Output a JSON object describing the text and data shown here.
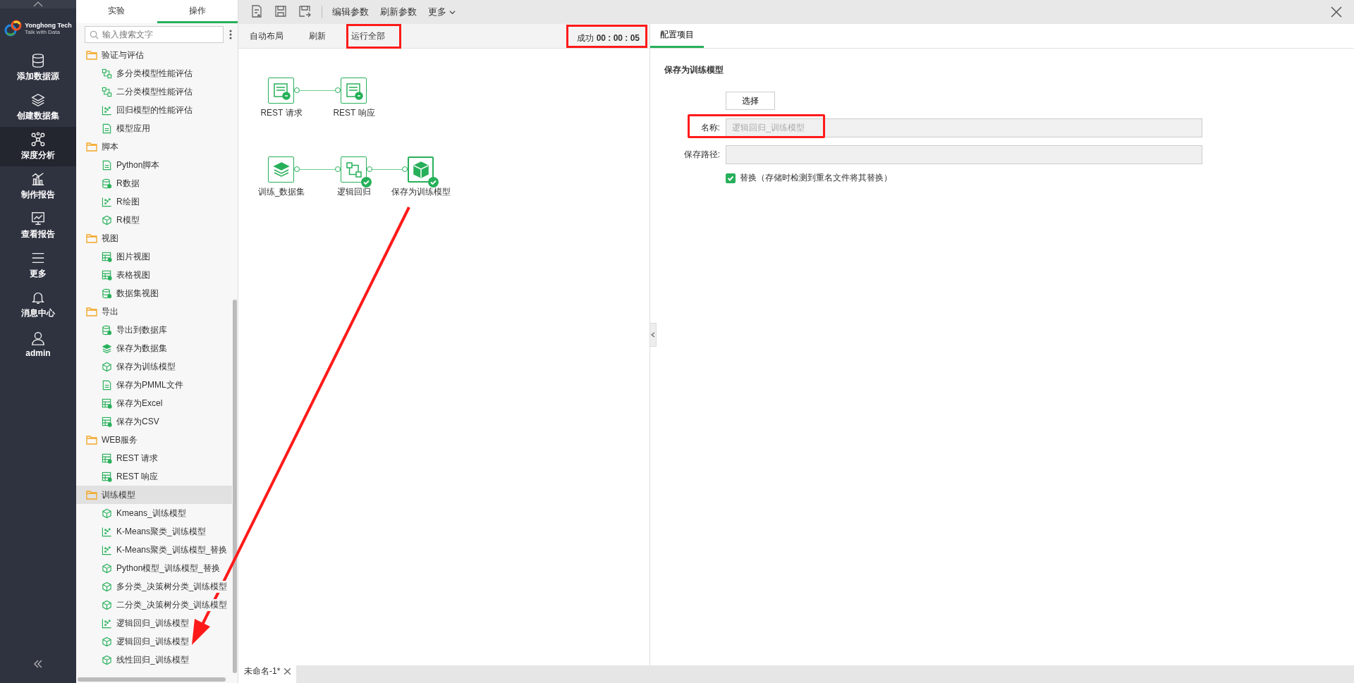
{
  "nav": {
    "logo": {
      "title": "Yonghong Tech",
      "tagline": "Talk with Data"
    },
    "items": [
      {
        "label": "添加数据源",
        "kind": "database",
        "selected": false
      },
      {
        "label": "创建数据集",
        "kind": "layers",
        "selected": false
      },
      {
        "label": "深度分析",
        "kind": "network",
        "selected": true
      },
      {
        "label": "制作报告",
        "kind": "chart",
        "selected": false
      },
      {
        "label": "查看报告",
        "kind": "monitor",
        "selected": false
      },
      {
        "label": "更多",
        "kind": "menu",
        "selected": false
      },
      {
        "label": "消息中心",
        "kind": "bell",
        "selected": false
      },
      {
        "label": "admin",
        "kind": "user",
        "selected": false
      }
    ]
  },
  "tree_panel": {
    "tabs": [
      {
        "label": "实验",
        "selected": false
      },
      {
        "label": "操作",
        "selected": true
      }
    ],
    "search": {
      "placeholder": "输入搜索文字"
    },
    "groups": [
      {
        "label": "验证与评估",
        "selected": false,
        "children": [
          {
            "label": "多分类模型性能评估",
            "kind": "flow"
          },
          {
            "label": "二分类模型性能评估",
            "kind": "flow"
          },
          {
            "label": "回归模型的性能评估",
            "kind": "scatter"
          },
          {
            "label": "模型应用",
            "kind": "doc"
          }
        ]
      },
      {
        "label": "脚本",
        "selected": false,
        "children": [
          {
            "label": "Python脚本",
            "kind": "doc"
          },
          {
            "label": "R数据",
            "kind": "db"
          },
          {
            "label": "R绘图",
            "kind": "scatter"
          },
          {
            "label": "R模型",
            "kind": "cube"
          }
        ]
      },
      {
        "label": "视图",
        "selected": false,
        "children": [
          {
            "label": "图片视图",
            "kind": "sheet"
          },
          {
            "label": "表格视图",
            "kind": "sheet"
          },
          {
            "label": "数据集视图",
            "kind": "db"
          }
        ]
      },
      {
        "label": "导出",
        "selected": false,
        "children": [
          {
            "label": "导出到数据库",
            "kind": "db"
          },
          {
            "label": "保存为数据集",
            "kind": "layers"
          },
          {
            "label": "保存为训练模型",
            "kind": "cube"
          },
          {
            "label": "保存为PMML文件",
            "kind": "doc"
          },
          {
            "label": "保存为Excel",
            "kind": "sheet"
          },
          {
            "label": "保存为CSV",
            "kind": "sheet"
          }
        ]
      },
      {
        "label": "WEB服务",
        "selected": false,
        "children": [
          {
            "label": "REST 请求",
            "kind": "sheet"
          },
          {
            "label": "REST 响应",
            "kind": "sheet"
          }
        ]
      },
      {
        "label": "训练模型",
        "selected": true,
        "children": [
          {
            "label": "Kmeans_训练模型",
            "kind": "cube"
          },
          {
            "label": "K-Means聚类_训练模型",
            "kind": "scatter"
          },
          {
            "label": "K-Means聚类_训练模型_替换",
            "kind": "scatter"
          },
          {
            "label": "Python模型_训练模型_替换",
            "kind": "cube"
          },
          {
            "label": "多分类_决策树分类_训练模型",
            "kind": "cube"
          },
          {
            "label": "二分类_决策树分类_训练模型",
            "kind": "cube"
          },
          {
            "label": "逻辑回归_训练模型",
            "kind": "scatter"
          },
          {
            "label": "逻辑回归_训练模型",
            "kind": "cube"
          },
          {
            "label": "线性回归_训练模型",
            "kind": "cube"
          }
        ]
      }
    ]
  },
  "toolbar": {
    "icons": [
      {
        "kind": "new"
      },
      {
        "kind": "save"
      },
      {
        "kind": "save-as"
      }
    ],
    "buttons": [
      "编辑参数",
      "刷新参数"
    ],
    "more": "更多"
  },
  "canvas_bar": {
    "actions": [
      {
        "label": "自动布局",
        "annotated": false
      },
      {
        "label": "刷新",
        "annotated": false
      },
      {
        "label": "运行全部",
        "annotated": true
      }
    ],
    "status": {
      "label": "成功",
      "time": "00 : 00 : 05",
      "annotated": true
    }
  },
  "canvas": {
    "rows": [
      [
        {
          "label": "REST 请求",
          "kind": "rest-in",
          "done": false,
          "selected": false
        },
        {
          "label": "REST 响应",
          "kind": "rest-out",
          "done": false,
          "selected": false
        }
      ],
      [
        {
          "label": "训练_数据集",
          "kind": "layers",
          "done": false,
          "selected": false
        },
        {
          "label": "逻辑回归",
          "kind": "flow",
          "done": true,
          "selected": false
        },
        {
          "label": "保存为训练模型",
          "kind": "cube",
          "done": true,
          "selected": true
        }
      ]
    ]
  },
  "config_panel": {
    "tabs": [
      {
        "label": "配置项目",
        "selected": true
      }
    ],
    "title": "保存为训练模型",
    "select_button": "选择",
    "fields": [
      {
        "label": "名称:",
        "value": "逻辑回归_训练模型",
        "disabled": true,
        "annotated": true
      },
      {
        "label": "保存路径:",
        "disabled": true,
        "annotated": false
      }
    ],
    "checkbox": {
      "label": "替换（存储时检测到重名文件将其替换）",
      "checked": true
    }
  },
  "doc_tabs": [
    {
      "label": "未命名-1*",
      "selected": true
    }
  ]
}
